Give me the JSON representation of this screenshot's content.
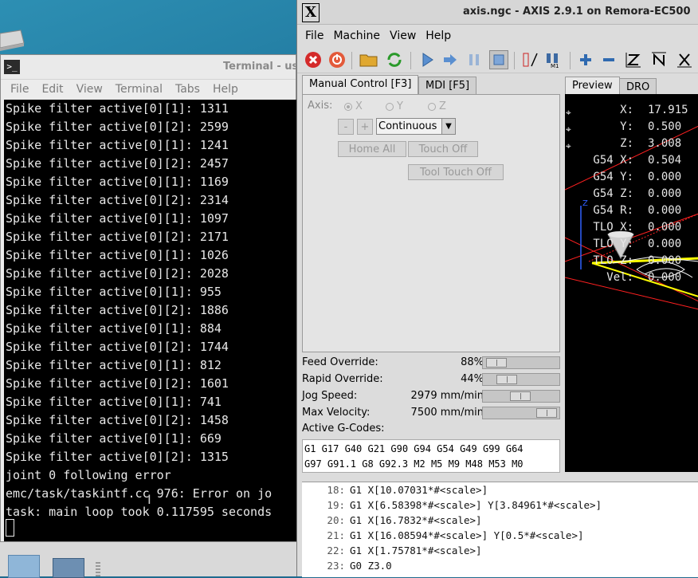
{
  "terminal": {
    "title": "Terminal - use",
    "menu": [
      "File",
      "Edit",
      "View",
      "Terminal",
      "Tabs",
      "Help"
    ],
    "icon_label": ">_",
    "lines": [
      "Spike filter active[0][1]: 1311",
      "Spike filter active[0][2]: 2599",
      "Spike filter active[0][1]: 1241",
      "Spike filter active[0][2]: 2457",
      "Spike filter active[0][1]: 1169",
      "Spike filter active[0][2]: 2314",
      "Spike filter active[0][1]: 1097",
      "Spike filter active[0][2]: 2171",
      "Spike filter active[0][1]: 1026",
      "Spike filter active[0][2]: 2028",
      "Spike filter active[0][1]: 955",
      "Spike filter active[0][2]: 1886",
      "Spike filter active[0][1]: 884",
      "Spike filter active[0][2]: 1744",
      "Spike filter active[0][1]: 812",
      "Spike filter active[0][2]: 1601",
      "Spike filter active[0][1]: 741",
      "Spike filter active[0][2]: 1458",
      "Spike filter active[0][1]: 669",
      "Spike filter active[0][2]: 1315",
      "joint 0 following error",
      "emc/task/taskintf.cc 976: Error on jo",
      "task: main loop took 0.117595 seconds"
    ]
  },
  "axis": {
    "title": "axis.ngc - AXIS 2.9.1 on Remora-EC500",
    "logo": "X",
    "menu": [
      "File",
      "Machine",
      "View",
      "Help"
    ],
    "tabs": [
      "Manual Control [F3]",
      "MDI [F5]"
    ],
    "manual": {
      "axis_label": "Axis:",
      "axes": [
        "X",
        "Y",
        "Z"
      ],
      "selected_axis": "X",
      "minus": "-",
      "plus": "+",
      "jog_mode": "Continuous",
      "home_all": "Home All",
      "touch_off": "Touch Off",
      "tool_touch_off": "Tool Touch Off"
    },
    "overrides": [
      {
        "label": "Feed Override:",
        "value": "88%",
        "level": 0.0
      },
      {
        "label": "Rapid Override:",
        "value": "44%",
        "level": 0.2
      },
      {
        "label": "Jog Speed:",
        "value": "2979 mm/min",
        "level": 0.45
      },
      {
        "label": "Max Velocity:",
        "value": "7500 mm/min",
        "level": 0.95
      }
    ],
    "gcodes_label": "Active G-Codes:",
    "gcodes": [
      "G1 G17 G40 G21 G90 G94 G54 G49 G99 G64",
      "G97 G91.1 G8 G92.3 M2 M5 M9 M48 M53 M0"
    ],
    "preview_tabs": [
      "Preview",
      "DRO"
    ],
    "dro": [
      {
        "name": "X:",
        "value": "17.915",
        "homed": true
      },
      {
        "name": "Y:",
        "value": "0.500",
        "homed": true
      },
      {
        "name": "Z:",
        "value": "3.008",
        "homed": true
      },
      {
        "name": "G54 X:",
        "value": "0.504",
        "homed": false
      },
      {
        "name": "G54 Y:",
        "value": "0.000",
        "homed": false
      },
      {
        "name": "G54 Z:",
        "value": "0.000",
        "homed": false
      },
      {
        "name": "G54 R:",
        "value": "0.000",
        "homed": false
      },
      {
        "name": "TLO X:",
        "value": "0.000",
        "homed": false
      },
      {
        "name": "TLO Y:",
        "value": "0.000",
        "homed": false
      },
      {
        "name": "TLO Z:",
        "value": "0.000",
        "homed": false
      },
      {
        "name": "Vel:",
        "value": "0.000",
        "homed": false
      }
    ],
    "program": [
      {
        "num": "18:",
        "code": "G1 X[10.07031*#<scale>]"
      },
      {
        "num": "19:",
        "code": "G1 X[6.58398*#<scale>] Y[3.84961*#<scale>]"
      },
      {
        "num": "20:",
        "code": "G1 X[16.7832*#<scale>]"
      },
      {
        "num": "21:",
        "code": "G1 X[16.08594*#<scale>] Y[0.5*#<scale>]"
      },
      {
        "num": "22:",
        "code": "G1 X[1.75781*#<scale>]"
      },
      {
        "num": "23:",
        "code": "G0 Z3.0"
      }
    ]
  },
  "colors": {
    "toolpath_feed": "#ffff00",
    "toolpath_rapid": "#ff2020",
    "axis_z": "#3060ff",
    "estop": "#cc2222"
  }
}
